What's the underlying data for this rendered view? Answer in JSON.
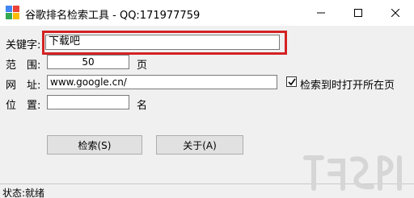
{
  "window": {
    "title": "谷歌排名检索工具 - QQ:171977759",
    "controls": [
      "minimize-icon",
      "maximize-icon",
      "close-icon"
    ]
  },
  "form": {
    "keyword": {
      "label": "关键字:",
      "value": "下载吧"
    },
    "range": {
      "label": "范　围:",
      "value": "50",
      "unit": "页"
    },
    "url": {
      "label": "网　址:",
      "value": "www.google.cn/"
    },
    "position": {
      "label": "位　置:",
      "value": "",
      "unit": "名"
    },
    "open_page_checkbox": {
      "label": "检索到时打开所在页",
      "checked": true
    }
  },
  "buttons": {
    "search": "检索(S)",
    "about": "关于(A)"
  },
  "statusbar": {
    "text": "状态:就绪"
  },
  "colors": {
    "highlight": "#d32222",
    "window_bg": "#f0f0f0"
  }
}
